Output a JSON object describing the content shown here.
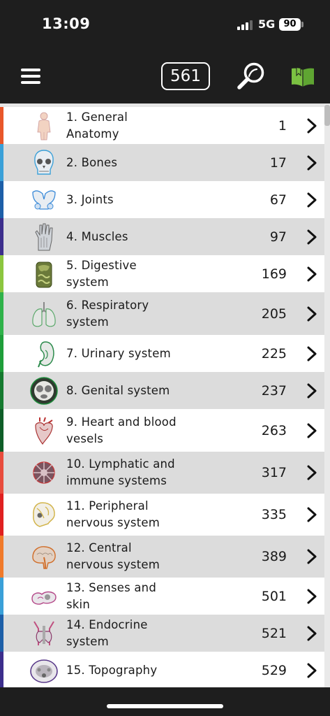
{
  "status_bar": {
    "time": "13:09",
    "network": "5G",
    "battery": "90"
  },
  "header": {
    "menu_icon": "hamburger-menu-icon",
    "count": "561",
    "search_icon": "magnifier-icon",
    "book_icon": "open-book-icon",
    "book_color": "#7bc142"
  },
  "chapters": [
    {
      "label": "1. General Anatomy",
      "page": "1",
      "color": "#e8572a",
      "icon": "body-figure-icon"
    },
    {
      "label": "2. Bones",
      "page": "17",
      "color": "#3aa0d8",
      "icon": "skull-icon"
    },
    {
      "label": "3. Joints",
      "page": "67",
      "color": "#1d5fa8",
      "icon": "pelvis-icon"
    },
    {
      "label": "4. Muscles",
      "page": "97",
      "color": "#3c2e8c",
      "icon": "hand-muscle-icon"
    },
    {
      "label": "5. Digestive system",
      "page": "169",
      "color": "#8cc63f",
      "icon": "digestive-organs-icon"
    },
    {
      "label": "6. Respiratory system",
      "page": "205",
      "color": "#2fb24a",
      "icon": "lungs-icon"
    },
    {
      "label": "7. Urinary system",
      "page": "225",
      "color": "#1f9e3a",
      "icon": "kidney-icon"
    },
    {
      "label": "8. Genital system",
      "page": "237",
      "color": "#157a2f",
      "icon": "cross-section-icon"
    },
    {
      "label": "9. Heart and blood vesels",
      "page": "263",
      "color": "#0e5e28",
      "icon": "heart-icon"
    },
    {
      "label": "10. Lymphatic and immune systems",
      "page": "317",
      "color": "#e84c3d",
      "icon": "lymph-node-icon"
    },
    {
      "label": "11. Peripheral nervous system",
      "page": "335",
      "color": "#e02020",
      "icon": "skull-nerves-icon"
    },
    {
      "label": "12. Central nervous system",
      "page": "389",
      "color": "#f07a2a",
      "icon": "brain-icon"
    },
    {
      "label": "13. Senses and skin",
      "page": "501",
      "color": "#3aa0d8",
      "icon": "ear-icon"
    },
    {
      "label": "14. Endocrine system",
      "page": "521",
      "color": "#1d5fa8",
      "icon": "thyroid-icon"
    },
    {
      "label": "15. Topography",
      "page": "529",
      "color": "#3c2e8c",
      "icon": "topography-section-icon"
    }
  ]
}
